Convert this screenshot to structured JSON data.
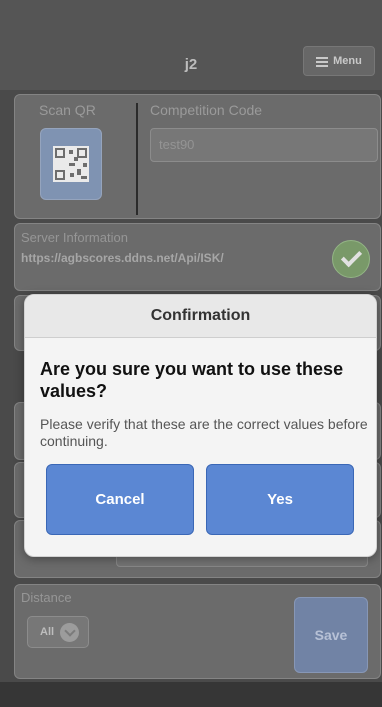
{
  "header": {
    "title": "j2",
    "menu_label": "Menu"
  },
  "scan": {
    "label": "Scan QR"
  },
  "competition": {
    "label": "Competition Code",
    "value": "test90"
  },
  "server": {
    "label": "Server Information",
    "url": "https://agbscores.ddns.net/Api/ISK/"
  },
  "distance": {
    "label": "Distance",
    "selected": "All"
  },
  "save_label": "Save",
  "dialog": {
    "title": "Confirmation",
    "question": "Are you sure you want to use these values?",
    "message": "Please verify that these are the correct values before continuing.",
    "cancel_label": "Cancel",
    "yes_label": "Yes"
  }
}
